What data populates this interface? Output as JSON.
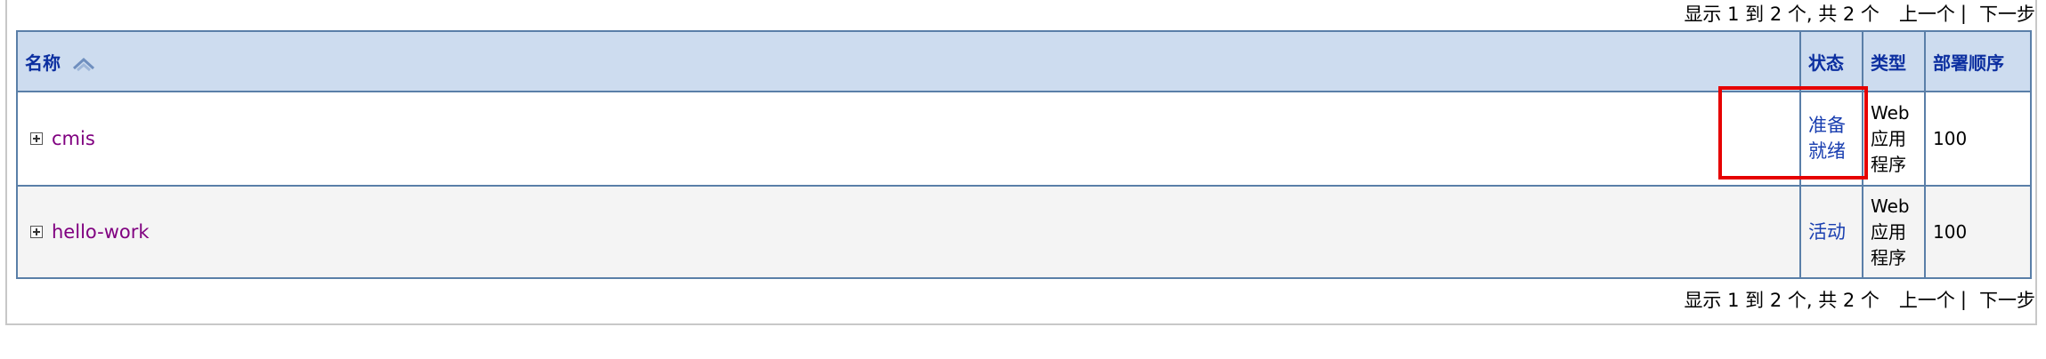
{
  "pager": {
    "summary": "显示 1 到 2 个, 共 2 个",
    "prev": "上一个",
    "separator": "|",
    "next": "下一步"
  },
  "table": {
    "headers": {
      "name": "名称",
      "status": "状态",
      "type": "类型",
      "deploy_order": "部署顺序"
    },
    "rows": [
      {
        "name": "cmis",
        "status_line1": "准备",
        "status_line2": "就绪",
        "type_line1": "Web",
        "type_line2": "应用",
        "type_line3": "程序",
        "deploy_order": "100"
      },
      {
        "name": "hello-work",
        "status_line1": "活动",
        "type_line1": "Web",
        "type_line2": "应用",
        "type_line3": "程序",
        "deploy_order": "100"
      }
    ]
  },
  "colors": {
    "header_bg": "#cddcef",
    "header_text": "#0c2fa0",
    "border": "#5a7fa8",
    "app_link": "#800080",
    "status_link": "#1a3fb0",
    "highlight": "#e60000"
  },
  "icons": {
    "sort": "sort-ascending-icon",
    "expand": "expand-plus-icon"
  }
}
